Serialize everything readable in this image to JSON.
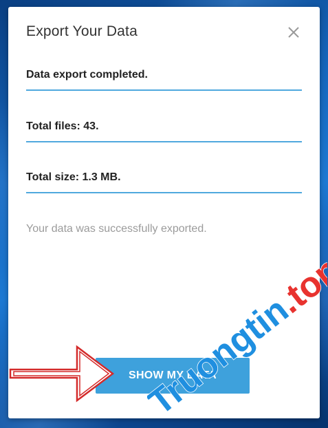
{
  "dialog": {
    "title": "Export Your Data",
    "close_icon": "close-icon",
    "fields": {
      "status": "Data export completed.",
      "total_files": "Total files: 43.",
      "total_size": "Total size: 1.3 MB."
    },
    "message": "Your data was successfully exported.",
    "primary_button_label": "SHOW MY DATA"
  },
  "annotation": {
    "arrow_icon": "right-arrow-icon",
    "arrow_color": "#d42a2a"
  },
  "watermark": {
    "text": "Truongtin.top",
    "color": "#1f8fe0",
    "accent_color": "#e8332f"
  },
  "colors": {
    "accent": "#3ea1dc",
    "field_underline": "#4fa8de",
    "desktop_blue": "#1667bd"
  }
}
